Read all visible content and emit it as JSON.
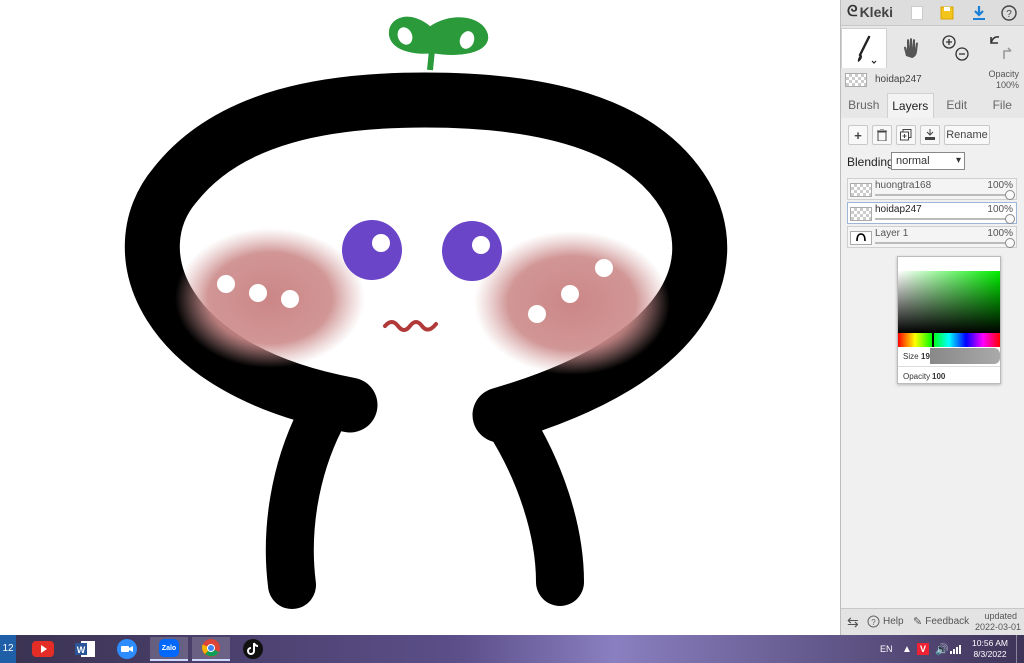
{
  "app": {
    "name": "Kleki",
    "logo_icon": "kleki-logo-icon"
  },
  "toolbar": {
    "top_icons": [
      "new-image-icon",
      "save-icon",
      "download-icon",
      "help-icon"
    ],
    "tools": [
      "brush-tool-icon",
      "hand-tool-icon",
      "zoom-in-icon",
      "zoom-out-icon",
      "undo-icon",
      "redo-icon"
    ]
  },
  "current_layer": {
    "name": "hoidap247",
    "opacity_label": "Opacity",
    "opacity_value": "100%"
  },
  "tabs": [
    "Brush",
    "Layers",
    "Edit",
    "File"
  ],
  "active_tab": "Layers",
  "layers_panel": {
    "rename_label": "Rename",
    "blending_label": "Blending",
    "blending_value": "normal",
    "layers": [
      {
        "name": "huongtra168",
        "opacity": "100%",
        "selected": false
      },
      {
        "name": "hoidap247",
        "opacity": "100%",
        "selected": true
      },
      {
        "name": "Layer 1",
        "opacity": "100%",
        "selected": false
      }
    ]
  },
  "color_picker": {
    "size_label": "Size",
    "size_value": "19",
    "opacity_label": "Opacity",
    "opacity_value": "100"
  },
  "bottom": {
    "help_label": "Help",
    "feedback_label": "Feedback",
    "updated_label": "updated",
    "updated_date": "2022-03-01"
  },
  "taskbar": {
    "left_number": "12",
    "apps": [
      "youtube-icon",
      "word-icon",
      "zoom-icon",
      "zalo-icon",
      "chrome-icon",
      "tiktok-icon"
    ],
    "zalo_label": "Zalo",
    "language": "EN",
    "time": "10:56 AM",
    "date": "8/3/2022"
  },
  "colors": {
    "accent_blue": "#1a7fd6",
    "save_yellow": "#f3c41b",
    "sprout_green": "#2a9a3a",
    "eye_purple": "#6a45c8",
    "blush_pink": "#c98484"
  }
}
